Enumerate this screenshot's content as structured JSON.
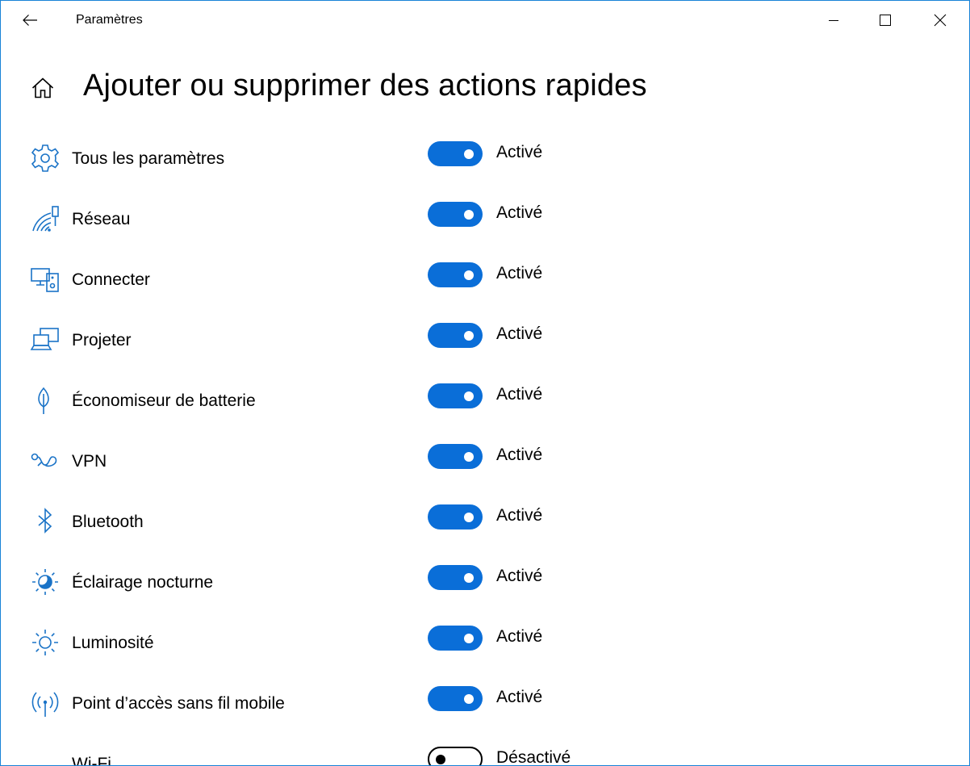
{
  "window": {
    "title": "Paramètres"
  },
  "titlebar": {
    "back_icon": "back-arrow-icon",
    "minimize_icon": "minimize-icon",
    "maximize_icon": "maximize-icon",
    "close_icon": "close-icon"
  },
  "page": {
    "home_icon": "home-icon",
    "title": "Ajouter ou supprimer des actions rapides"
  },
  "colors": {
    "accent": "#0a6ed8",
    "icon": "#1a73c7",
    "window_border": "#1883d7"
  },
  "actions": [
    {
      "icon": "gear-icon",
      "label": "Tous les paramètres",
      "state": "Activé",
      "on": true
    },
    {
      "icon": "network-icon",
      "label": "Réseau",
      "state": "Activé",
      "on": true
    },
    {
      "icon": "connect-icon",
      "label": "Connecter",
      "state": "Activé",
      "on": true
    },
    {
      "icon": "project-icon",
      "label": "Projeter",
      "state": "Activé",
      "on": true
    },
    {
      "icon": "battery-saver-leaf-icon",
      "label": "Économiseur de batterie",
      "state": "Activé",
      "on": true
    },
    {
      "icon": "vpn-icon",
      "label": "VPN",
      "state": "Activé",
      "on": true
    },
    {
      "icon": "bluetooth-icon",
      "label": "Bluetooth",
      "state": "Activé",
      "on": true
    },
    {
      "icon": "night-light-icon",
      "label": "Éclairage nocturne",
      "state": "Activé",
      "on": true
    },
    {
      "icon": "brightness-icon",
      "label": "Luminosité",
      "state": "Activé",
      "on": true
    },
    {
      "icon": "mobile-hotspot-icon",
      "label": "Point d’accès sans fil mobile",
      "state": "Activé",
      "on": true
    },
    {
      "icon": "wifi-icon",
      "label": "Wi-Fi",
      "state": "Désactivé",
      "on": false
    }
  ]
}
